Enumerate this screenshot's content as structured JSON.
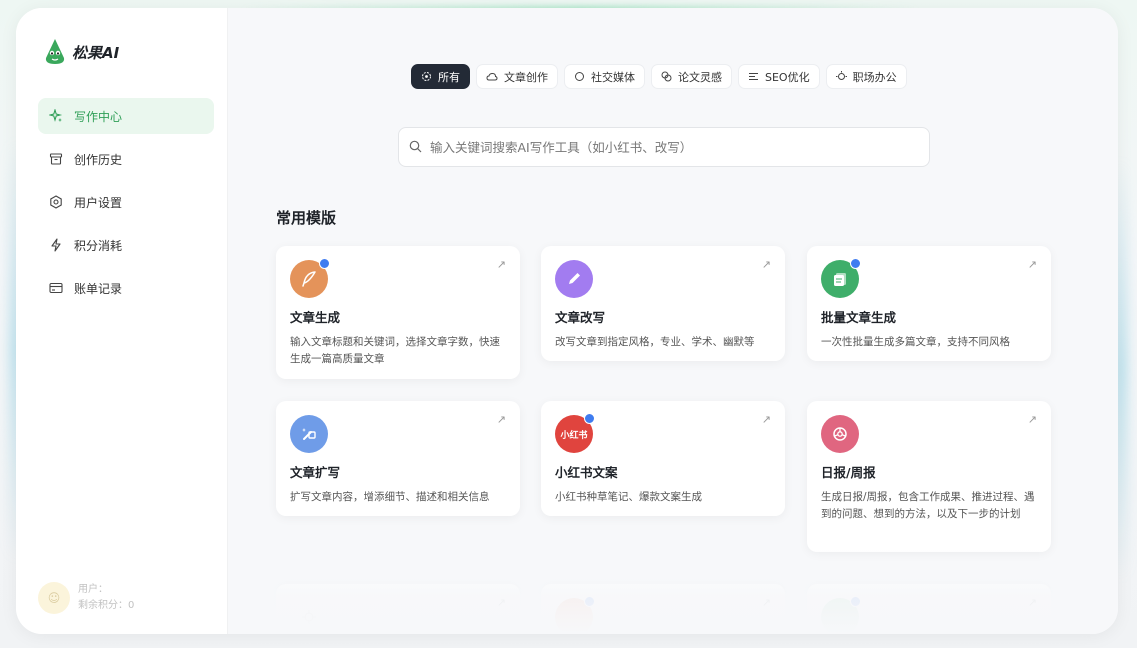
{
  "brand": {
    "name": "松果AI"
  },
  "sidebar": {
    "items": [
      {
        "label": "写作中心",
        "icon": "sparkle-icon",
        "active": true
      },
      {
        "label": "创作历史",
        "icon": "archive-icon"
      },
      {
        "label": "用户设置",
        "icon": "gear-icon"
      },
      {
        "label": "积分消耗",
        "icon": "lightning-icon"
      },
      {
        "label": "账单记录",
        "icon": "card-icon"
      }
    ]
  },
  "user": {
    "name": "用户：",
    "points": "剩余积分：0"
  },
  "tabs": [
    {
      "label": "所有",
      "icon": "target-icon",
      "active": true
    },
    {
      "label": "文章创作",
      "icon": "cloud-icon"
    },
    {
      "label": "社交媒体",
      "icon": "circle-icon"
    },
    {
      "label": "论文灵感",
      "icon": "copy-icon"
    },
    {
      "label": "SEO优化",
      "icon": "lines-icon"
    },
    {
      "label": "职场办公",
      "icon": "sun-icon"
    }
  ],
  "search": {
    "placeholder": "输入关键词搜索AI写作工具（如小红书、改写）"
  },
  "section": {
    "title": "常用模版"
  },
  "cards": [
    {
      "title": "文章生成",
      "desc": "输入文章标题和关键词，选择文章字数，快速生成一篇高质量文章",
      "color": "#e4935a",
      "icon": "quill-icon",
      "badge": true
    },
    {
      "title": "文章改写",
      "desc": "改写文章到指定风格，专业、学术、幽默等",
      "color": "#a27cf0",
      "icon": "pencil-icon",
      "badge": false
    },
    {
      "title": "批量文章生成",
      "desc": "一次性批量生成多篇文章，支持不同风格",
      "color": "#3fae6a",
      "icon": "documents-icon",
      "badge": true
    },
    {
      "title": "文章扩写",
      "desc": "扩写文章内容，增添细节、描述和相关信息",
      "color": "#6f9ce8",
      "icon": "wand-icon",
      "badge": false
    },
    {
      "title": "小红书文案",
      "desc": "小红书种草笔记、爆款文案生成",
      "color": "#e0443e",
      "icon": "xiaohongshu-icon",
      "icon_text": "小红书",
      "badge": true
    },
    {
      "title": "日报/周报",
      "desc": "生成日报/周报，包含工作成果、推进过程、遇到的问题、想到的方法，以及下一步的计划",
      "color": "#e06680",
      "icon": "aperture-icon",
      "badge": false
    },
    {
      "title": "",
      "desc": "",
      "color": "#dddddd",
      "icon": "crosshair-icon",
      "badge": false
    },
    {
      "title": "",
      "desc": "",
      "color": "#f2a184",
      "icon": "gear-icon",
      "badge": true
    },
    {
      "title": "",
      "desc": "",
      "color": "#9fd3b0",
      "icon": "square-icon",
      "badge": true
    }
  ]
}
